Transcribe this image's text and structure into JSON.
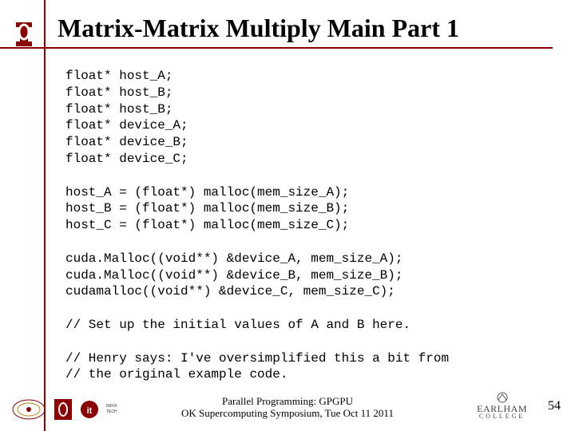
{
  "title": "Matrix-Matrix Multiply Main Part 1",
  "code": {
    "l1": "float* host_A;",
    "l2": "float* host_B;",
    "l3": "float* host_B;",
    "l4": "float* device_A;",
    "l5": "float* device_B;",
    "l6": "float* device_C;",
    "l7": "",
    "l8": "host_A = (float*) malloc(mem_size_A);",
    "l9": "host_B = (float*) malloc(mem_size_B);",
    "l10": "host_C = (float*) malloc(mem_size_C);",
    "l11": "",
    "l12": "cuda.Malloc((void**) &device_A, mem_size_A);",
    "l13": "cuda.Malloc((void**) &device_B, mem_size_B);",
    "l14": "cudamalloc((void**) &device_C, mem_size_C);",
    "l15": "",
    "l16": "// Set up the initial values of A and B here.",
    "l17": "",
    "l18": "// Henry says: I've oversimplified this a bit from",
    "l19": "// the original example code."
  },
  "footer": {
    "line1": "Parallel Programming: GPGPU",
    "line2": "OK Supercomputing Symposium, Tue Oct 11 2011"
  },
  "page_number": "54",
  "logos": {
    "ou": "ou-logo",
    "oscer": "oscer-logo",
    "ou_small": "ou-logo-small",
    "it": "it-logo",
    "earlham_top": "EARLHAM",
    "earlham_bot": "COLLEGE"
  }
}
